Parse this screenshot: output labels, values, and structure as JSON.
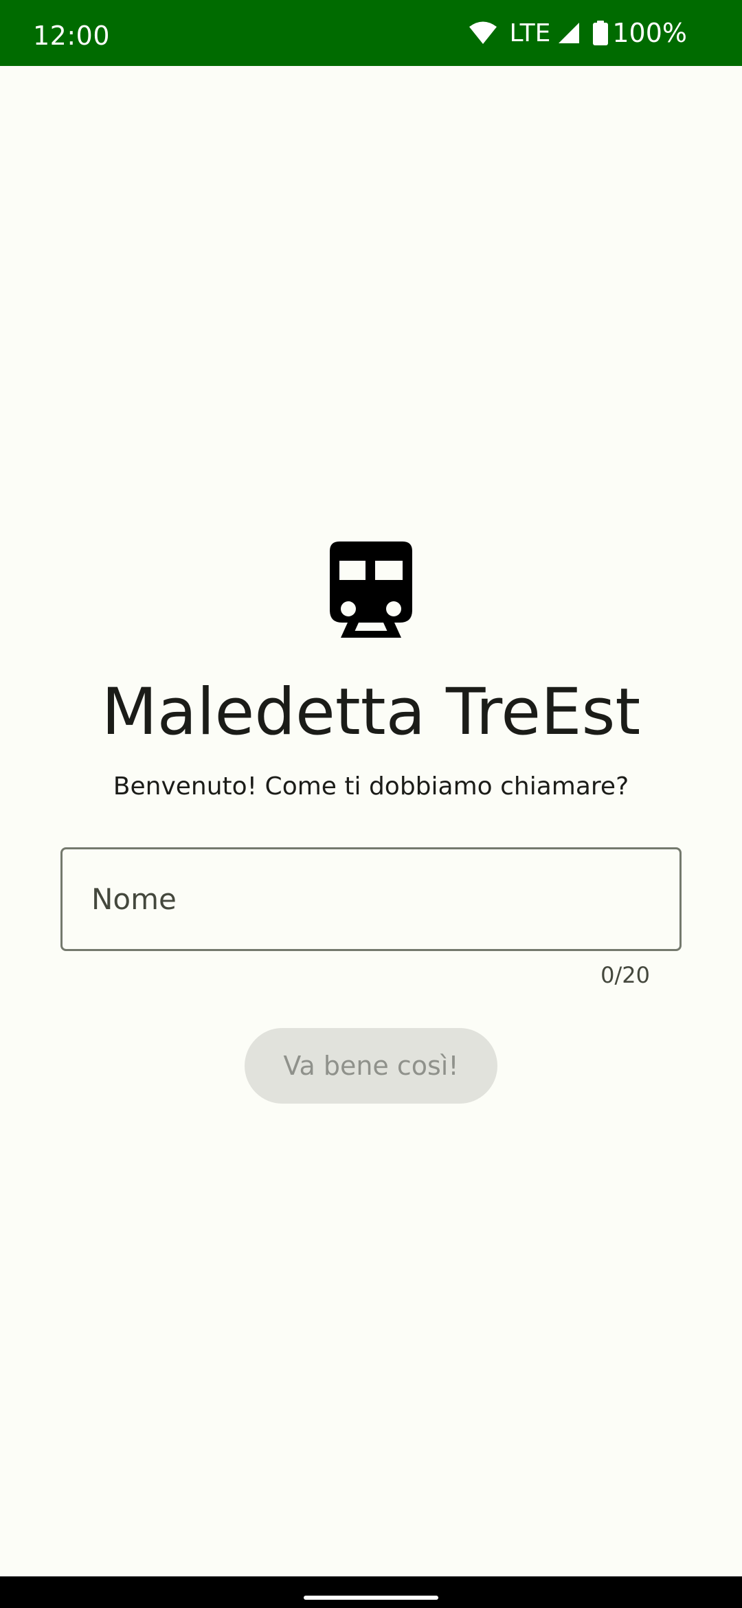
{
  "status_bar": {
    "time": "12:00",
    "network": "LTE",
    "battery": "100%",
    "icons": [
      "wifi-icon",
      "cell-signal-icon",
      "battery-icon"
    ]
  },
  "app": {
    "icon": "train-icon",
    "title": "Maledetta TreEst",
    "subtitle": "Benvenuto! Come ti dobbiamo chiamare?"
  },
  "form": {
    "name_field": {
      "placeholder": "Nome",
      "value": "",
      "counter": "0/20"
    },
    "confirm_label": "Va bene così!"
  },
  "colors": {
    "status_bar": "#006b00",
    "background": "#fcfdf7",
    "button_disabled_bg": "#e1e2dc",
    "button_disabled_text": "#8f918b"
  }
}
